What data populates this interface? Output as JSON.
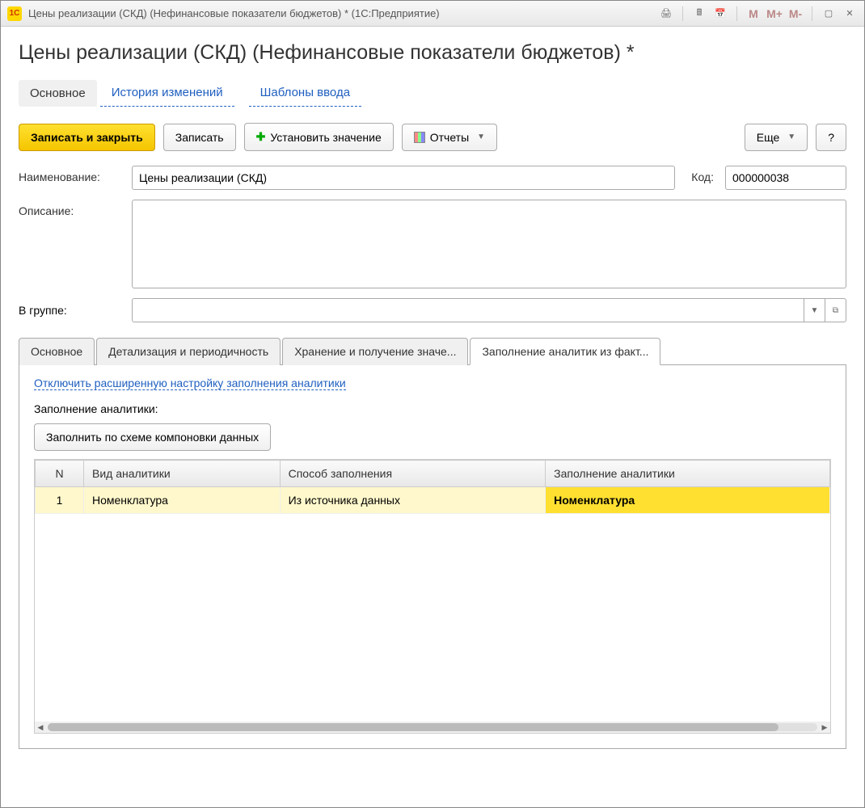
{
  "titlebar": {
    "app_icon_text": "1C",
    "title": "Цены реализации (СКД) (Нефинансовые показатели бюджетов) *  (1С:Предприятие)"
  },
  "page": {
    "title": "Цены реализации (СКД) (Нефинансовые показатели бюджетов) *"
  },
  "nav": {
    "main": "Основное",
    "history": "История изменений",
    "templates": "Шаблоны ввода"
  },
  "toolbar": {
    "save_close": "Записать и закрыть",
    "save": "Записать",
    "set_value": "Установить значение",
    "reports": "Отчеты",
    "more": "Еще",
    "help": "?"
  },
  "fields": {
    "name_label": "Наименование:",
    "name_value": "Цены реализации (СКД)",
    "code_label": "Код:",
    "code_value": "000000038",
    "desc_label": "Описание:",
    "desc_value": "",
    "group_label": "В группе:",
    "group_value": ""
  },
  "tabs": {
    "t1": "Основное",
    "t2": "Детализация и периодичность",
    "t3": "Хранение и получение значе...",
    "t4": "Заполнение аналитик из факт..."
  },
  "tab4": {
    "disable_link": "Отключить расширенную настройку заполнения аналитики",
    "sub_label": "Заполнение аналитики:",
    "fill_btn": "Заполнить по схеме компоновки данных",
    "cols": {
      "n": "N",
      "kind": "Вид аналитики",
      "method": "Способ заполнения",
      "fill": "Заполнение аналитики"
    },
    "rows": [
      {
        "n": "1",
        "kind": "Номенклатура",
        "method": "Из источника данных",
        "fill": "Номенклатура"
      }
    ]
  }
}
